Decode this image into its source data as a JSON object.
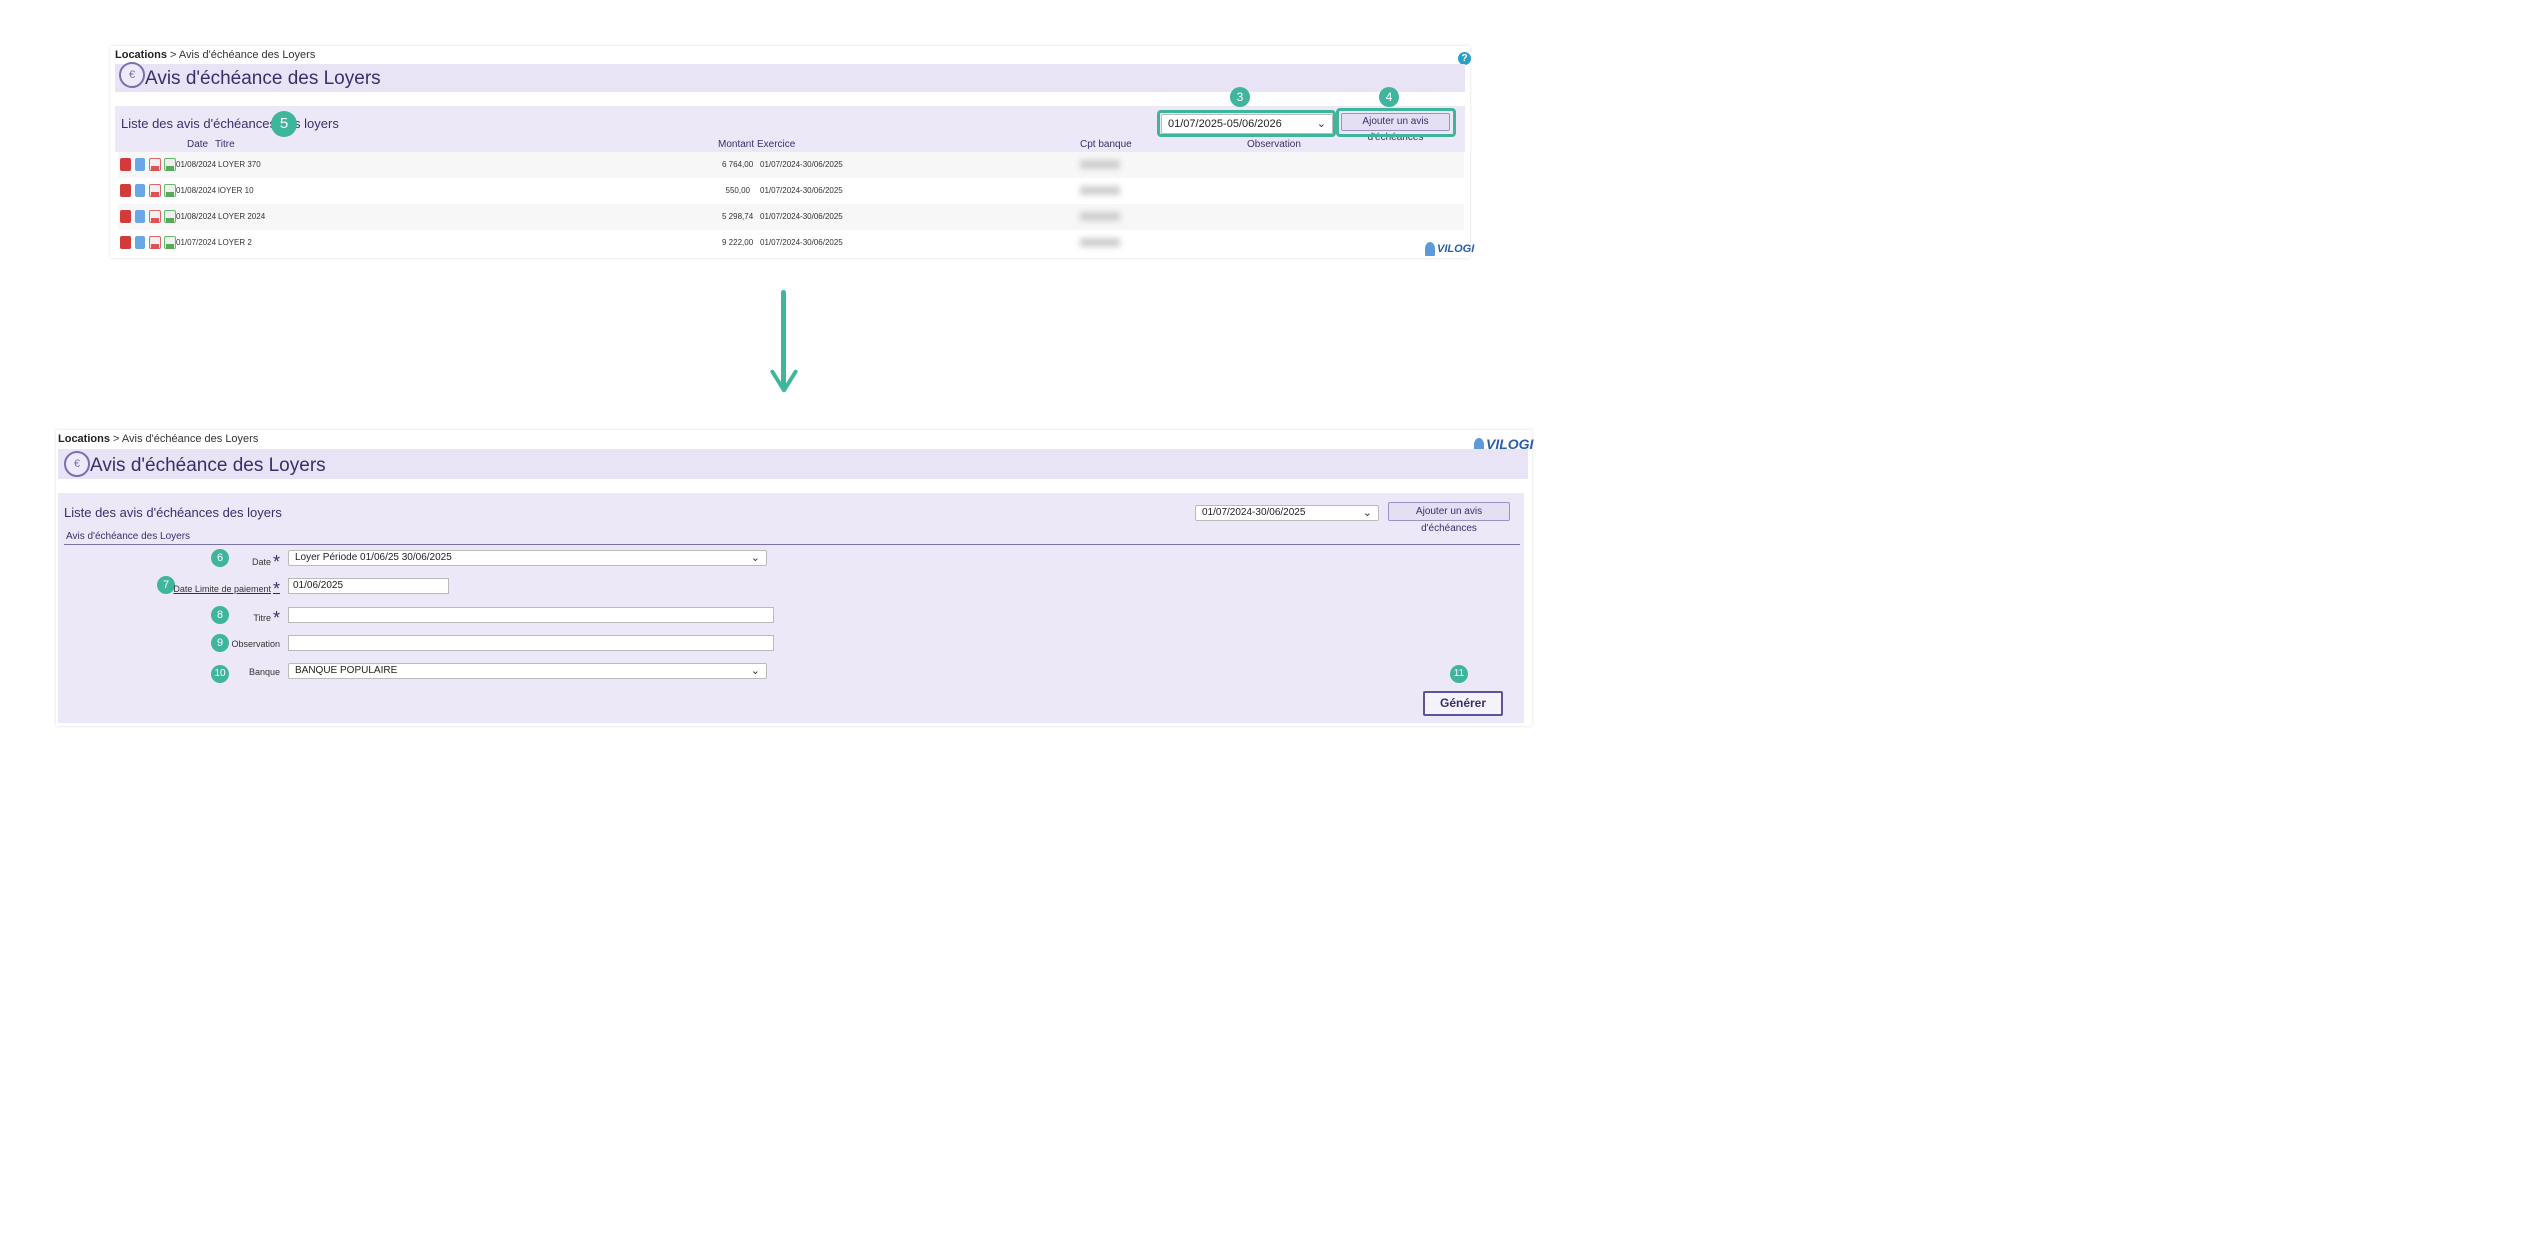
{
  "top": {
    "breadcrumb": {
      "root": "Locations",
      "sep": ">",
      "current": "Avis d'échéance des Loyers"
    },
    "help_label": "?",
    "page_title": "Avis d'échéance des Loyers",
    "list_title": "Liste des avis d'échéances des loyers",
    "period_select_value": "01/07/2025-05/06/2026",
    "add_button_label": "Ajouter un avis d'échéances",
    "columns": [
      "Date",
      "Titre",
      "Montant",
      "Exercice",
      "Cpt banque",
      "Observation"
    ],
    "rows": [
      {
        "date": "01/08/2024",
        "titre": "LOYER 370",
        "montant": "6 764,00",
        "exercice": "01/07/2024-30/06/2025"
      },
      {
        "date": "01/08/2024",
        "titre": "lOYER 10",
        "montant": "550,00",
        "exercice": "01/07/2024-30/06/2025"
      },
      {
        "date": "01/08/2024",
        "titre": "LOYER 2024",
        "montant": "5 298,74",
        "exercice": "01/07/2024-30/06/2025"
      },
      {
        "date": "01/07/2024",
        "titre": "LOYER 2",
        "montant": "9 222,00",
        "exercice": "01/07/2024-30/06/2025"
      }
    ],
    "logo_text": "VILOGI"
  },
  "bottom": {
    "breadcrumb": {
      "root": "Locations",
      "sep": ">",
      "current": "Avis d'échéance des Loyers"
    },
    "page_title": "Avis d'échéance des Loyers",
    "list_title": "Liste des avis d'échéances des loyers",
    "period_select_value": "01/07/2024-30/06/2025",
    "add_button_label": "Ajouter un avis d'échéances",
    "form_section_title": "Avis d'échéance des Loyers",
    "fields": {
      "date_label": "Date",
      "date_value": "Loyer Période 01/06/25 30/06/2025",
      "deadline_label": "Date Limite de paiement",
      "deadline_value": "01/06/2025",
      "titre_label": "Titre",
      "titre_value": "",
      "observation_label": "Observation",
      "observation_value": "",
      "banque_label": "Banque",
      "banque_value": "BANQUE POPULAIRE"
    },
    "required_mark": "*",
    "generate_button_label": "Générer",
    "logo_text": "VILOGI"
  },
  "badges": [
    "3",
    "4",
    "5",
    "6",
    "7",
    "8",
    "9",
    "10",
    "11"
  ],
  "colors": {
    "accent": "#3fb59c",
    "panel": "#e8e3f5",
    "text": "#3a2f6b"
  }
}
